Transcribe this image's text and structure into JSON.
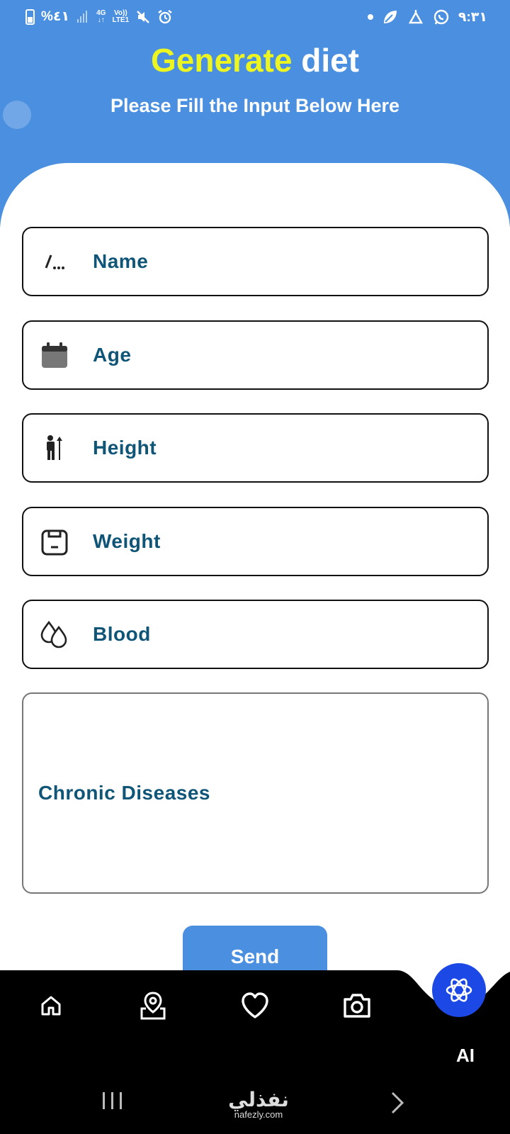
{
  "status_bar": {
    "battery_percent": "%٤١",
    "network_type": "4G",
    "volte": "Vo))",
    "lte": "LTE1",
    "time": "٩:٣١"
  },
  "header": {
    "title_accent": "Generate",
    "title_rest": "diet",
    "subtitle": "Please Fill the Input Below Here",
    "accent_color": "#ecf520",
    "background_color": "#4a8fe0"
  },
  "form": {
    "fields": [
      {
        "label": "Name",
        "icon": "text-cursor-icon"
      },
      {
        "label": "Age",
        "icon": "calendar-icon"
      },
      {
        "label": "Height",
        "icon": "person-height-icon"
      },
      {
        "label": "Weight",
        "icon": "scale-icon"
      },
      {
        "label": "Blood",
        "icon": "blood-drops-icon"
      }
    ],
    "chronic_diseases_label": "Chronic Diseases",
    "send_label": "Send",
    "label_color": "#0f5577"
  },
  "bottom_nav": {
    "items": [
      {
        "icon": "home-icon"
      },
      {
        "icon": "map-pin-icon"
      },
      {
        "icon": "heart-icon"
      },
      {
        "icon": "camera-icon"
      }
    ],
    "ai_label": "AI",
    "ai_color": "#1c49e6"
  },
  "watermark": {
    "arabic": "نفذلي",
    "domain": "nafezly.com"
  }
}
